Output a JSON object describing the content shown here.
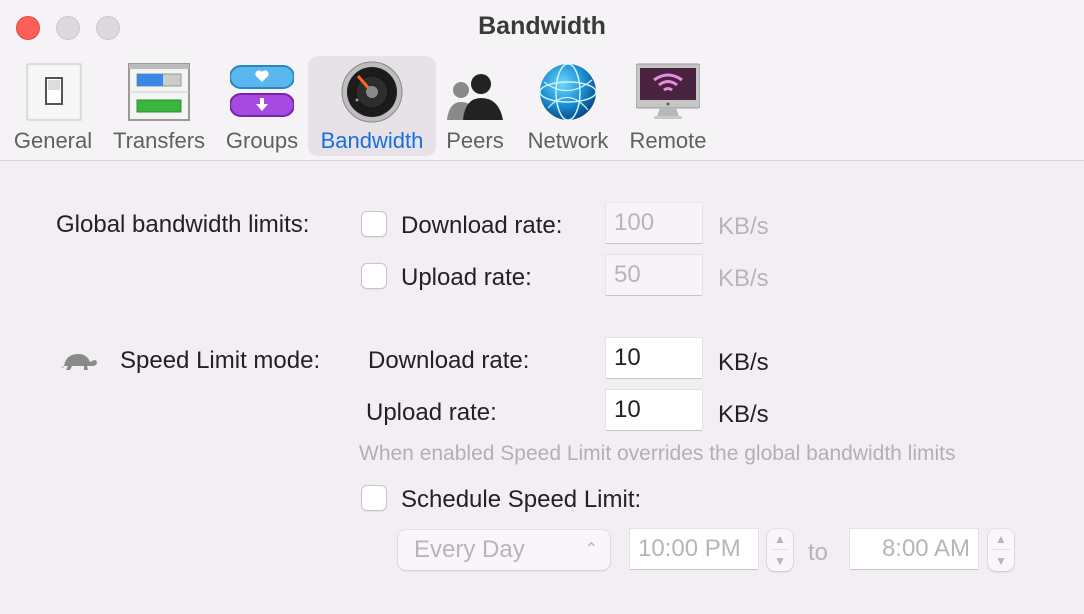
{
  "window": {
    "title": "Bandwidth"
  },
  "toolbar": {
    "tabs": [
      {
        "label": "General",
        "icon": "light-switch-icon",
        "active": false
      },
      {
        "label": "Transfers",
        "icon": "transfers-icon",
        "active": false
      },
      {
        "label": "Groups",
        "icon": "groups-icon",
        "active": false
      },
      {
        "label": "Bandwidth",
        "icon": "speedometer-icon",
        "active": true
      },
      {
        "label": "Peers",
        "icon": "people-icon",
        "active": false
      },
      {
        "label": "Network",
        "icon": "globe-icon",
        "active": false
      },
      {
        "label": "Remote",
        "icon": "remote-monitor-icon",
        "active": false
      }
    ]
  },
  "global_limits": {
    "label": "Global bandwidth limits:",
    "download": {
      "label": "Download rate:",
      "checked": false,
      "value": "100",
      "unit": "KB/s"
    },
    "upload": {
      "label": "Upload rate:",
      "checked": false,
      "value": "50",
      "unit": "KB/s"
    }
  },
  "speed_limit": {
    "icon": "turtle-icon",
    "label": "Speed Limit mode:",
    "download": {
      "label": "Download rate:",
      "value": "10",
      "unit": "KB/s"
    },
    "upload": {
      "label": "Upload rate:",
      "value": "10",
      "unit": "KB/s"
    },
    "hint": "When enabled Speed Limit overrides the global bandwidth limits"
  },
  "schedule": {
    "label": "Schedule Speed Limit:",
    "checked": false,
    "day": "Every Day",
    "from_time": "10:00 PM",
    "to_label": "to",
    "to_time": "8:00 AM"
  },
  "colors": {
    "accent": "#1a6fdc",
    "close_button": "#ff5f57",
    "background": "#f2eef3"
  }
}
